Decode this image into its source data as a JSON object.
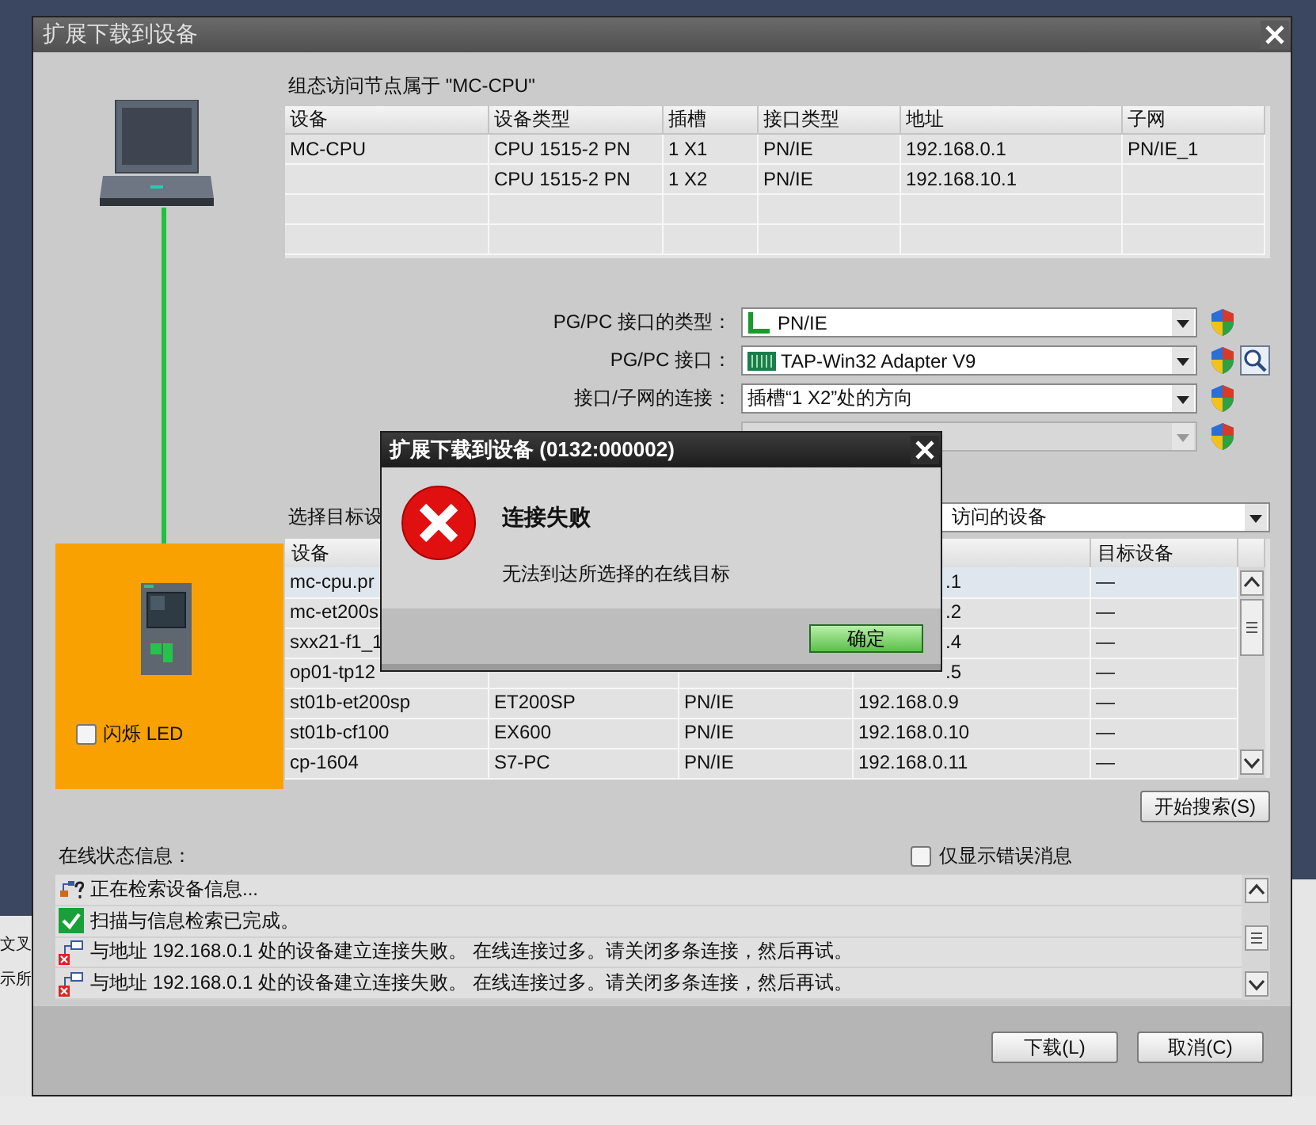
{
  "background": {
    "left_texts": [
      "文叉",
      "示所"
    ]
  },
  "window": {
    "title": "扩展下载到设备"
  },
  "config": {
    "caption": "组态访问节点属于 \"MC-CPU\"",
    "columns": [
      "设备",
      "设备类型",
      "插槽",
      "接口类型",
      "地址",
      "子网"
    ],
    "rows": [
      {
        "device": "MC-CPU",
        "type": "CPU 1515-2 PN",
        "slot": "1 X1",
        "interface": "PN/IE",
        "address": "192.168.0.1",
        "subnet": "PN/IE_1"
      },
      {
        "type": "CPU 1515-2 PN",
        "slot": "1 X2",
        "interface": "PN/IE",
        "address": "192.168.10.1"
      }
    ]
  },
  "flash_led": {
    "label": "闪烁 LED",
    "checked": false
  },
  "settings": [
    {
      "kind": "interface-type",
      "label": "PG/PC 接口的类型：",
      "value": "PN/IE",
      "disabled": false
    },
    {
      "kind": "adapter",
      "label": "PG/PC 接口：",
      "value": "TAP-Win32 Adapter V9",
      "disabled": false
    },
    {
      "kind": "connection",
      "label": "接口/子网的连接：",
      "value": "插槽“1 X2”处的方向",
      "disabled": false
    },
    {
      "kind": "gateway",
      "disabled": true
    }
  ],
  "target": {
    "label": "选择目标设",
    "value": "访问的设备"
  },
  "devices": {
    "columns": {
      "device": "设备",
      "target": "目标设备"
    },
    "rows": [
      {
        "device": "mc-cpu.pr",
        "address": ".1",
        "target": "—",
        "selected": true
      },
      {
        "device": "mc-et200s",
        "address": ".2",
        "target": "—",
        "selected": false
      },
      {
        "device": "sxx21-f1_1",
        "address": ".4",
        "target": "—",
        "selected": false
      },
      {
        "device": "op01-tp12",
        "address": ".5",
        "target": "—",
        "selected": false
      },
      {
        "device": "st01b-et200sp",
        "type": "ET200SP",
        "interface": "PN/IE",
        "address": "192.168.0.9",
        "target": "—",
        "selected": false
      },
      {
        "device": "st01b-cf100",
        "type": "EX600",
        "interface": "PN/IE",
        "address": "192.168.0.10",
        "target": "—",
        "selected": false
      },
      {
        "device": "cp-1604",
        "type": "S7-PC",
        "interface": "PN/IE",
        "address": "192.168.0.11",
        "target": "—",
        "selected": false
      }
    ]
  },
  "search_button": "开始搜索(S)",
  "status": {
    "label": "在线状态信息：",
    "errors_only": {
      "label": "仅显示错误消息",
      "checked": false
    },
    "messages": [
      {
        "kind": "progress",
        "text": "正在检索设备信息..."
      },
      {
        "kind": "success",
        "text": "扫描与信息检索已完成。"
      },
      {
        "kind": "error",
        "text": "与地址 192.168.0.1 处的设备建立连接失败。 在线连接过多。请关闭多条连接，然后再试。"
      },
      {
        "kind": "error",
        "text": "与地址 192.168.0.1 处的设备建立连接失败。 在线连接过多。请关闭多条连接，然后再试。"
      }
    ]
  },
  "buttons": [
    {
      "label": "下载(L)"
    },
    {
      "label": "取消(C)"
    }
  ],
  "dialog": {
    "title": "扩展下载到设备 (0132:000002)",
    "heading": "连接失败",
    "message": "无法到达所选择的在线目标",
    "button": "确定"
  }
}
